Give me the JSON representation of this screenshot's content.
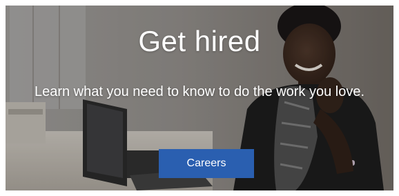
{
  "hero": {
    "title": "Get hired",
    "subtitle": "Learn what you need to know to do the work you love.",
    "cta_label": "Careers"
  },
  "colors": {
    "cta_background": "#2a5fb0",
    "text": "#ffffff",
    "backdrop": "#6e6862"
  }
}
